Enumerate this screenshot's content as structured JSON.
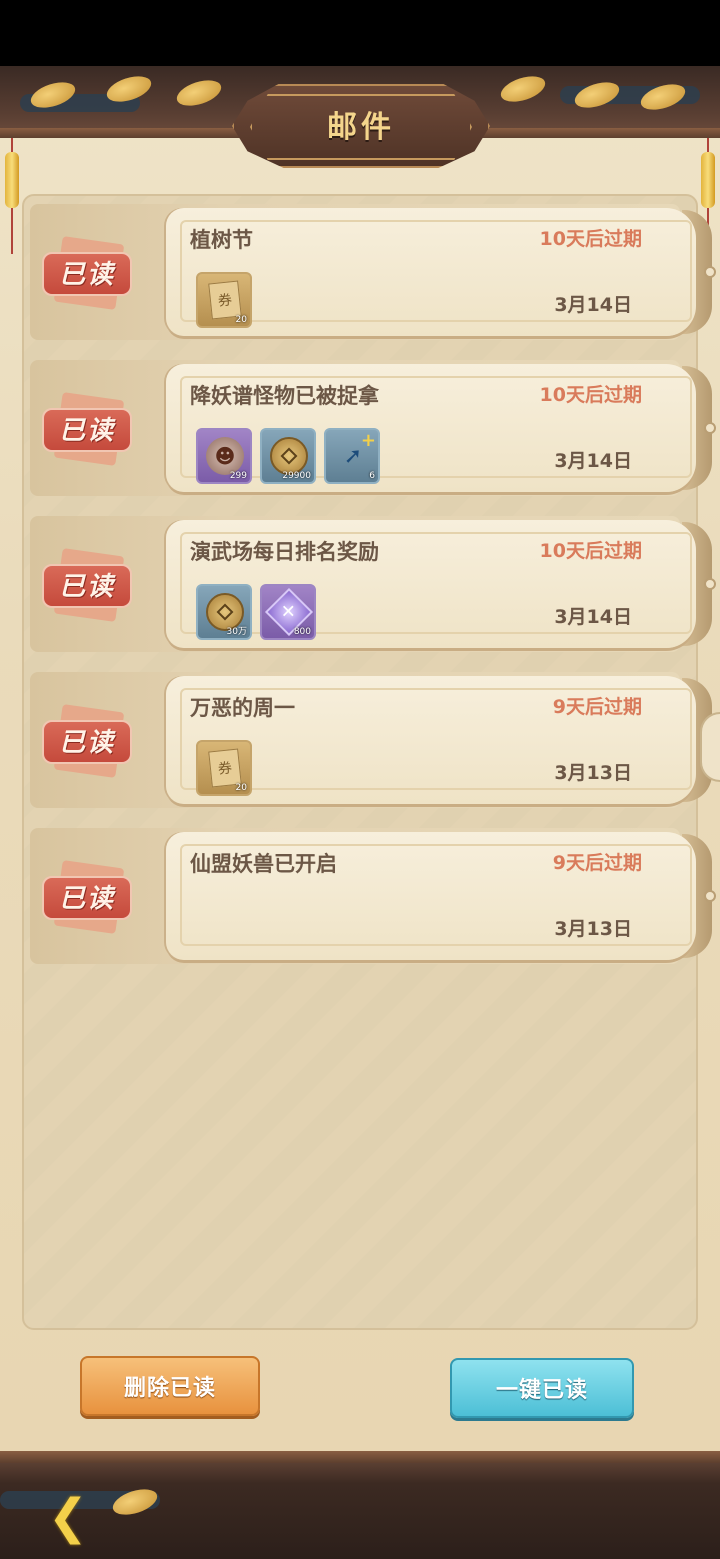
{
  "header": {
    "title": "邮件"
  },
  "mails": [
    {
      "title": "植树节",
      "expire": "10天后过期",
      "date": "3月14日",
      "status": "已读",
      "items": [
        {
          "kind": "paper",
          "count": "20",
          "style": "gold",
          "icon": "voucher-icon"
        }
      ]
    },
    {
      "title": "降妖谱怪物已被捉拿",
      "expire": "10天后过期",
      "date": "3月14日",
      "status": "已读",
      "items": [
        {
          "kind": "demon",
          "count": "299",
          "style": "purple",
          "icon": "demon-token-icon"
        },
        {
          "kind": "coin",
          "count": "29900",
          "style": "blue",
          "icon": "copper-coin-icon"
        },
        {
          "kind": "scroll",
          "count": "6",
          "style": "blue",
          "icon": "upgrade-scroll-icon"
        }
      ]
    },
    {
      "title": "演武场每日排名奖励",
      "expire": "10天后过期",
      "date": "3月14日",
      "status": "已读",
      "items": [
        {
          "kind": "coin",
          "count": "30万",
          "style": "blue",
          "icon": "copper-coin-icon"
        },
        {
          "kind": "crystal",
          "count": "800",
          "style": "purple",
          "icon": "purple-crystal-icon"
        }
      ]
    },
    {
      "title": "万恶的周一",
      "expire": "9天后过期",
      "date": "3月13日",
      "status": "已读",
      "items": [
        {
          "kind": "paper",
          "count": "20",
          "style": "gold",
          "icon": "voucher-icon"
        }
      ]
    },
    {
      "title": "仙盟妖兽已开启",
      "expire": "9天后过期",
      "date": "3月13日",
      "status": "已读",
      "items": []
    }
  ],
  "buttons": {
    "delete_read": "删除已读",
    "mark_all_read": "一键已读"
  },
  "footer": {
    "back_icon": "back-arrow-icon"
  },
  "colors": {
    "expire": "#d97b5b",
    "text": "#6c5746",
    "stamp": "#c54a3c",
    "title": "#f4d58c"
  }
}
